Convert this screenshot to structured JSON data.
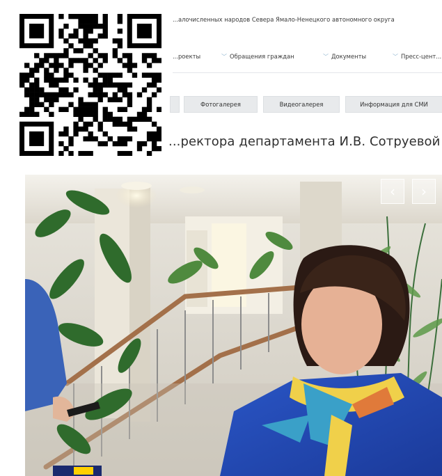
{
  "header": {
    "org_line": "...алочисленных народов Севера Ямало-Ненецкого автономного округа"
  },
  "nav": {
    "items": [
      {
        "label": "...роекты",
        "chevron": false
      },
      {
        "label": "Обращения граждан",
        "chevron": true
      },
      {
        "label": "Документы",
        "chevron": true
      },
      {
        "label": "Пресс-цент...",
        "chevron": true
      }
    ]
  },
  "tabs": [
    {
      "label": "Фотогалерея"
    },
    {
      "label": "Видеогалерея"
    },
    {
      "label": "Информация для СМИ"
    }
  ],
  "article": {
    "heading": "...ректора департамента И.В. Сотруевой"
  },
  "gallery": {
    "prev_icon": "chevron-left-icon",
    "next_icon": "chevron-right-icon",
    "prev_glyph": "‹",
    "next_glyph": "›"
  },
  "colors": {
    "nav_chevron": "#8ab2cf",
    "tab_bg": "#e8eaec"
  }
}
